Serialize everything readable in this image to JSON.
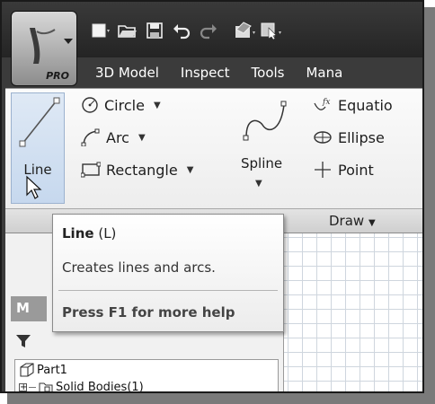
{
  "app": {
    "edition": "PRO"
  },
  "quick_access": {
    "icons": [
      "new-file-icon",
      "open-folder-icon",
      "save-icon",
      "undo-icon",
      "redo-icon",
      "material-icon",
      "appearance-icon"
    ]
  },
  "menu": {
    "tabs": [
      "3D Model",
      "Inspect",
      "Tools",
      "Mana"
    ]
  },
  "ribbon": {
    "line": "Line",
    "circle": "Circle",
    "arc": "Arc",
    "rectangle": "Rectangle",
    "spline": "Spline",
    "equation": "Equatio",
    "ellipse": "Ellipse",
    "point": "Point",
    "panel_label": "Draw"
  },
  "tooltip": {
    "title": "Line",
    "shortcut": "(L)",
    "description": "Creates lines and arcs.",
    "help": "Press F1 for more help"
  },
  "browser": {
    "tab_letter": "M",
    "tree": [
      {
        "label": "Part1"
      },
      {
        "label": "Solid Bodies(1)"
      }
    ]
  },
  "colors": {
    "titlebar": "#2e2e2e",
    "ribbon": "#f2f2f2",
    "line_highlight": "#c6d8ee",
    "grid": "#cfd6de"
  }
}
